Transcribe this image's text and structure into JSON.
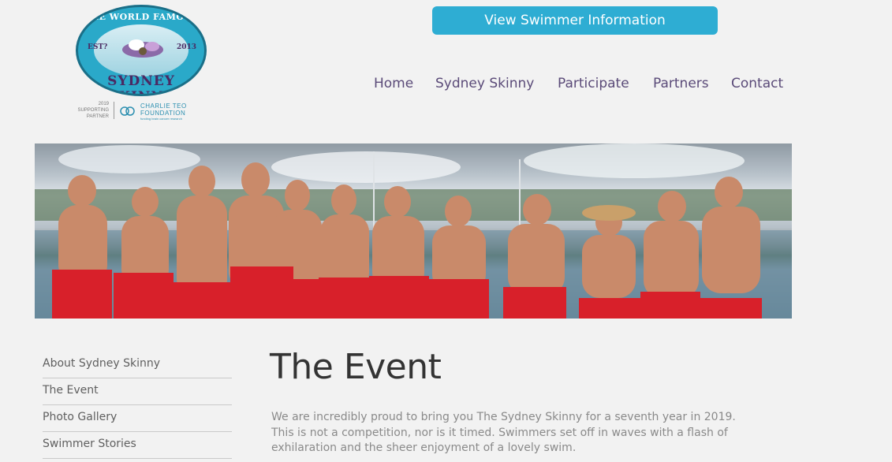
{
  "logo": {
    "top_text": "THE WORLD FAMOUS",
    "bottom_text": "SYDNEY SKINNY",
    "est": "EST?",
    "year": "2013",
    "partner_year_label": "2019",
    "partner_supporting": "SUPPORTING",
    "partner_partner": "PARTNER",
    "partner_name_1": "CHARLIE TEO",
    "partner_name_2": "FOUNDATION",
    "partner_tagline": "funding brain cancer research"
  },
  "header": {
    "swimmer_button_label": "View Swimmer Information"
  },
  "nav": {
    "items": [
      {
        "label": "Home"
      },
      {
        "label": "Sydney Skinny"
      },
      {
        "label": "Participate"
      },
      {
        "label": "Partners"
      },
      {
        "label": "Contact"
      }
    ]
  },
  "sidebar": {
    "items": [
      {
        "label": "About Sydney Skinny"
      },
      {
        "label": "The Event"
      },
      {
        "label": "Photo Gallery"
      },
      {
        "label": "Swimmer Stories"
      }
    ]
  },
  "main": {
    "title": "The Event",
    "intro": "We are incredibly proud to bring you The Sydney Skinny for a seventh year in 2019. This is not a competition, nor is it timed. Swimmers set off in waves with a flash of exhilaration and the sheer enjoyment of a lovely swim."
  },
  "colors": {
    "background": "#f2f2f2",
    "button": "#2eadd3",
    "nav_text": "#5a4a78",
    "sarong_red": "#d8202a"
  }
}
